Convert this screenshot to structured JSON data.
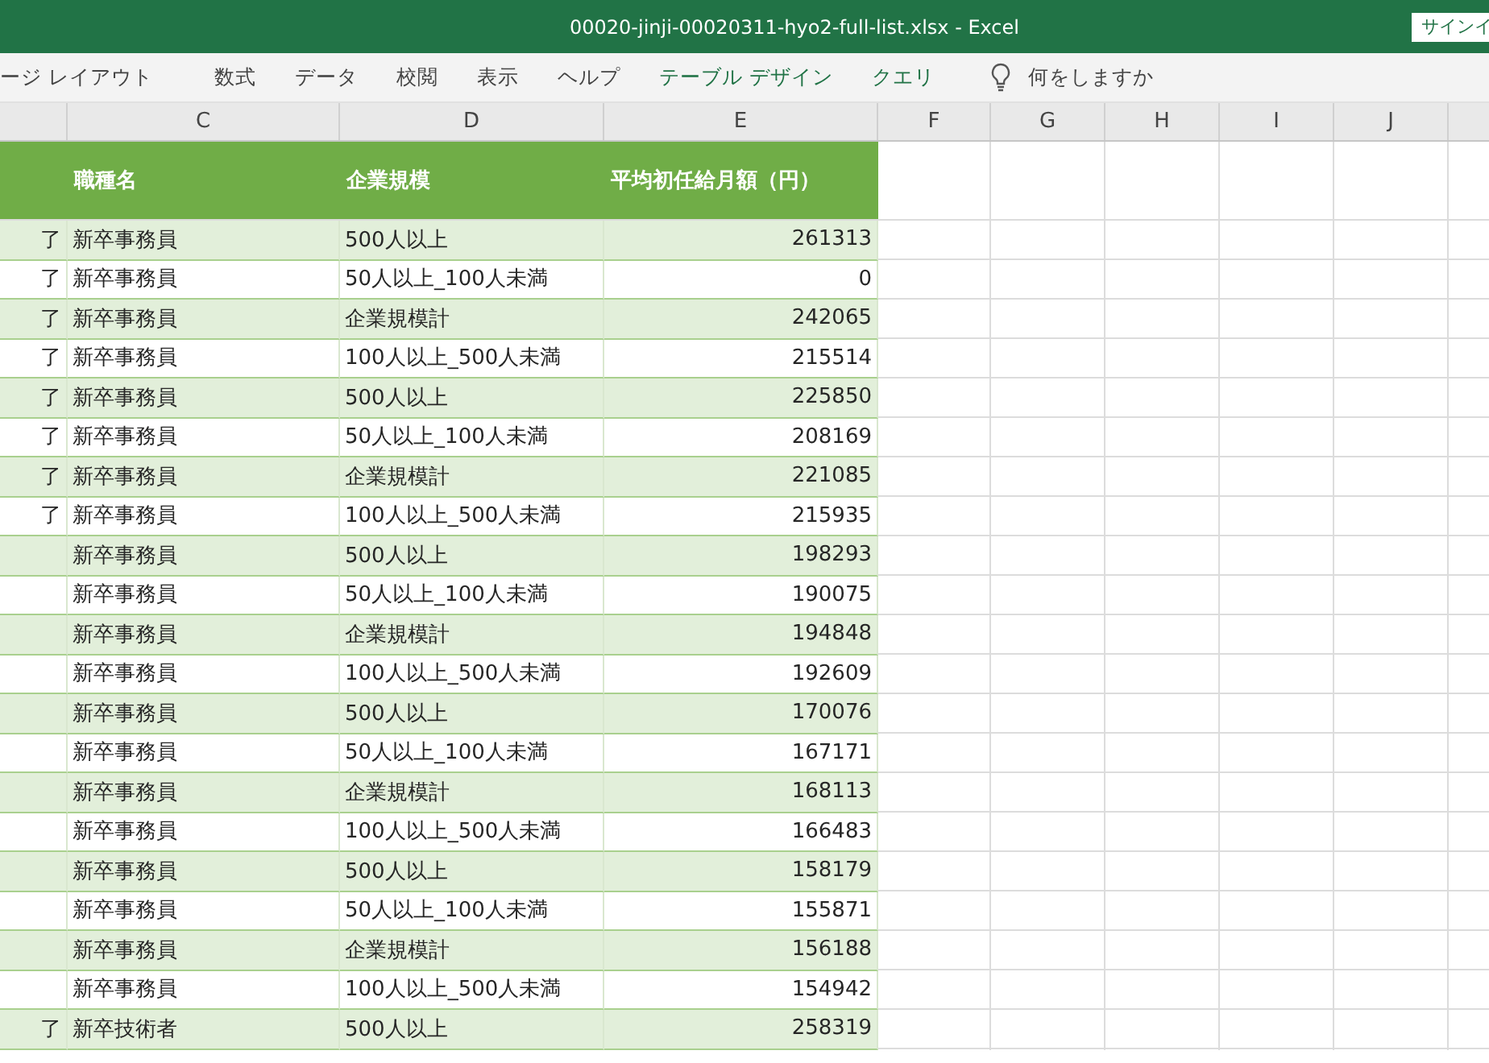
{
  "window": {
    "title": "00020-jinji-00020311-hyo2-full-list.xlsx  -  Excel",
    "signin_button": "サインイ"
  },
  "ribbon": {
    "tabs": [
      {
        "label": "ージ レイアウト",
        "kind": "normal"
      },
      {
        "label": "数式",
        "kind": "normal"
      },
      {
        "label": "データ",
        "kind": "normal"
      },
      {
        "label": "校閲",
        "kind": "normal"
      },
      {
        "label": "表示",
        "kind": "normal"
      },
      {
        "label": "ヘルプ",
        "kind": "normal"
      },
      {
        "label": "テーブル デザイン",
        "kind": "contextual"
      },
      {
        "label": "クエリ",
        "kind": "contextual"
      }
    ],
    "tell_me": {
      "placeholder": "何をしますか"
    }
  },
  "column_letters": [
    "C",
    "D",
    "E",
    "F",
    "G",
    "H",
    "I",
    "J"
  ],
  "table": {
    "headers": [
      "職種名",
      "企業規模",
      "平均初任給月額（円）"
    ],
    "rows": [
      [
        "了",
        "新卒事務員",
        "500人以上",
        "261313"
      ],
      [
        "了",
        "新卒事務員",
        "50人以上_100人未満",
        "0"
      ],
      [
        "了",
        "新卒事務員",
        "企業規模計",
        "242065"
      ],
      [
        "了",
        "新卒事務員",
        "100人以上_500人未満",
        "215514"
      ],
      [
        "了",
        "新卒事務員",
        "500人以上",
        "225850"
      ],
      [
        "了",
        "新卒事務員",
        "50人以上_100人未満",
        "208169"
      ],
      [
        "了",
        "新卒事務員",
        "企業規模計",
        "221085"
      ],
      [
        "了",
        "新卒事務員",
        "100人以上_500人未満",
        "215935"
      ],
      [
        "",
        "新卒事務員",
        "500人以上",
        "198293"
      ],
      [
        "",
        "新卒事務員",
        "50人以上_100人未満",
        "190075"
      ],
      [
        "",
        "新卒事務員",
        "企業規模計",
        "194848"
      ],
      [
        "",
        "新卒事務員",
        "100人以上_500人未満",
        "192609"
      ],
      [
        "",
        "新卒事務員",
        "500人以上",
        "170076"
      ],
      [
        "",
        "新卒事務員",
        "50人以上_100人未満",
        "167171"
      ],
      [
        "",
        "新卒事務員",
        "企業規模計",
        "168113"
      ],
      [
        "",
        "新卒事務員",
        "100人以上_500人未満",
        "166483"
      ],
      [
        "",
        "新卒事務員",
        "500人以上",
        "158179"
      ],
      [
        "",
        "新卒事務員",
        "50人以上_100人未満",
        "155871"
      ],
      [
        "",
        "新卒事務員",
        "企業規模計",
        "156188"
      ],
      [
        "",
        "新卒事務員",
        "100人以上_500人未満",
        "154942"
      ],
      [
        "了",
        "新卒技術者",
        "500人以上",
        "258319"
      ]
    ]
  }
}
